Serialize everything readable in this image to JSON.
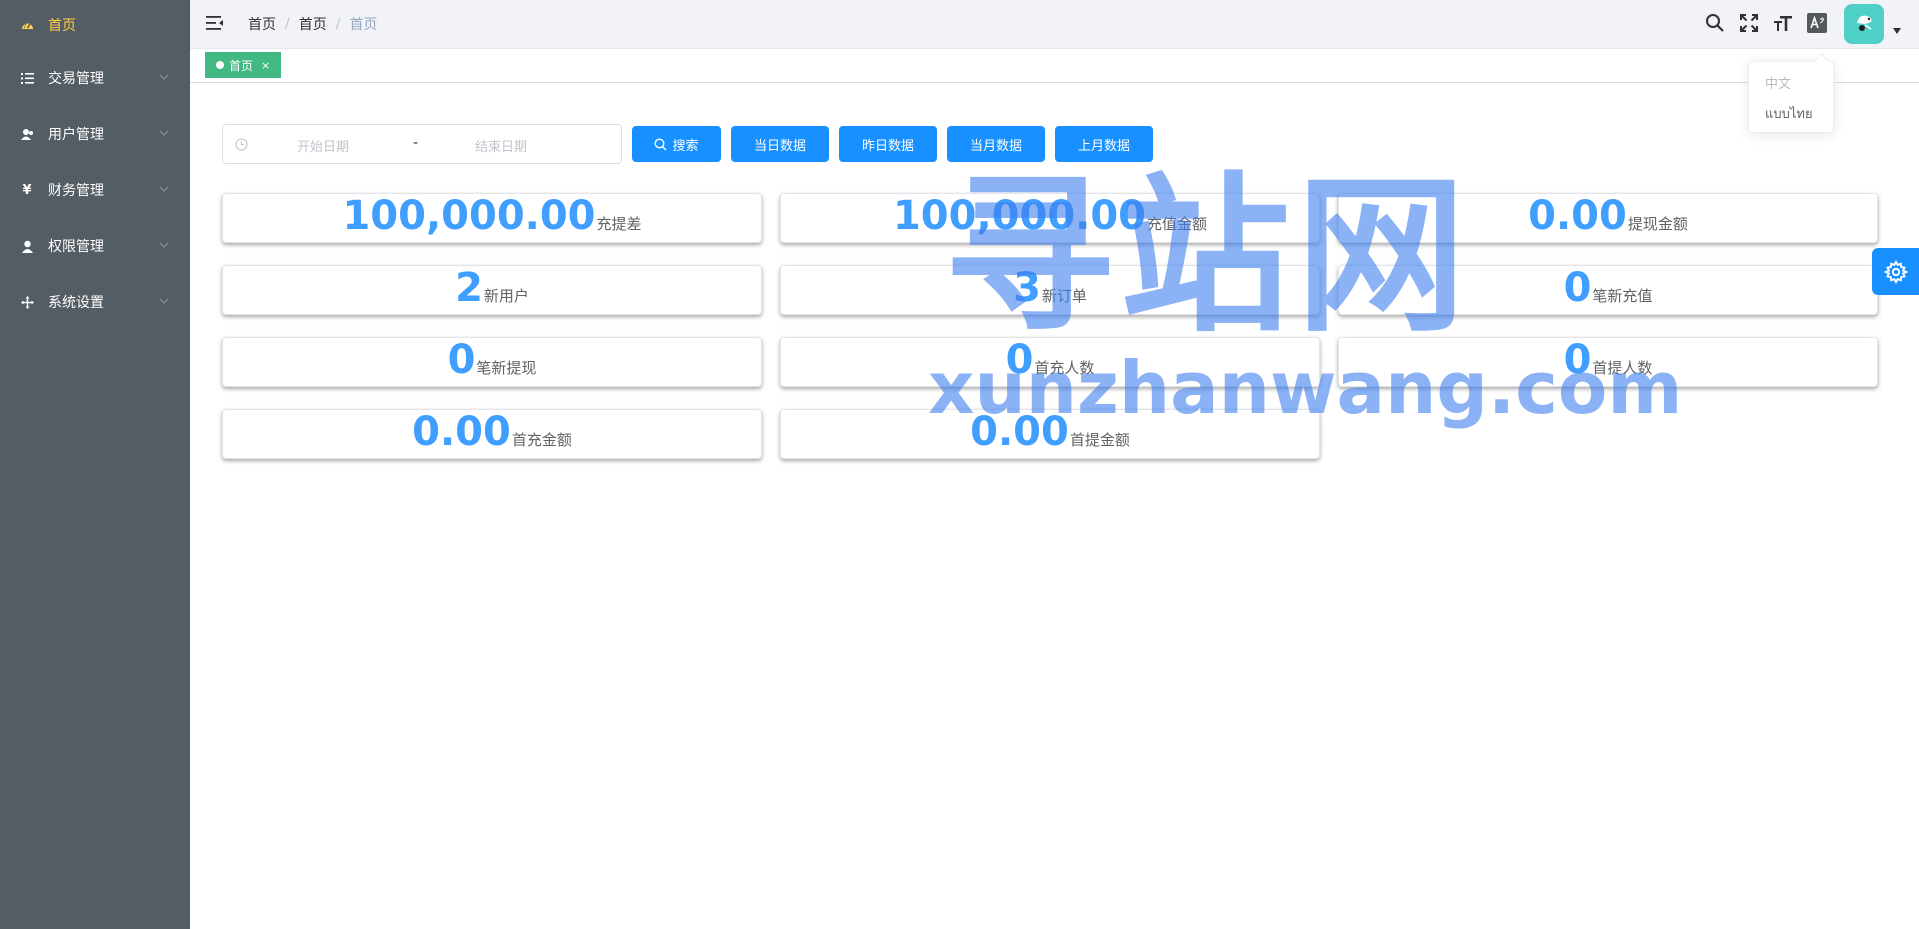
{
  "sidebar": {
    "items": [
      {
        "label": "首页",
        "icon": "dashboard-icon",
        "active": true
      },
      {
        "label": "交易管理",
        "icon": "list-icon"
      },
      {
        "label": "用户管理",
        "icon": "user-group-icon"
      },
      {
        "label": "财务管理",
        "icon": "yen-icon"
      },
      {
        "label": "权限管理",
        "icon": "user-icon"
      },
      {
        "label": "系统设置",
        "icon": "move-icon"
      }
    ]
  },
  "breadcrumb": [
    "首页",
    "首页",
    "首页"
  ],
  "tags": [
    {
      "label": "首页",
      "close": "×"
    }
  ],
  "language_menu": {
    "options": [
      "中文",
      "แบบไทย"
    ]
  },
  "filter": {
    "start_placeholder": "开始日期",
    "separator": "-",
    "end_placeholder": "结束日期",
    "search_button": "搜索",
    "buttons": [
      "当日数据",
      "昨日数据",
      "当月数据",
      "上月数据"
    ]
  },
  "stats": [
    {
      "value": "100,000.00",
      "label": "充提差"
    },
    {
      "value": "100,000.00",
      "label": "充值金额"
    },
    {
      "value": "0.00",
      "label": "提现金额"
    },
    {
      "value": "2",
      "label": "新用户"
    },
    {
      "value": "3",
      "label": "新订单"
    },
    {
      "value": "0",
      "label": "笔新充值"
    },
    {
      "value": "0",
      "label": "笔新提现"
    },
    {
      "value": "0",
      "label": "首充人数"
    },
    {
      "value": "0",
      "label": "首提人数"
    },
    {
      "value": "0.00",
      "label": "首充金额"
    },
    {
      "value": "0.00",
      "label": "首提金额"
    }
  ],
  "watermark": {
    "chinese": "寻站网",
    "domain": "xunzhanwang.com"
  },
  "colors": {
    "sidebar_bg": "#545c64",
    "active_menu": "#ffd04b",
    "primary": "#1890ff",
    "stat_number": "#409eff",
    "tag_green": "#42b983",
    "avatar_bg": "#4fd0c7"
  }
}
